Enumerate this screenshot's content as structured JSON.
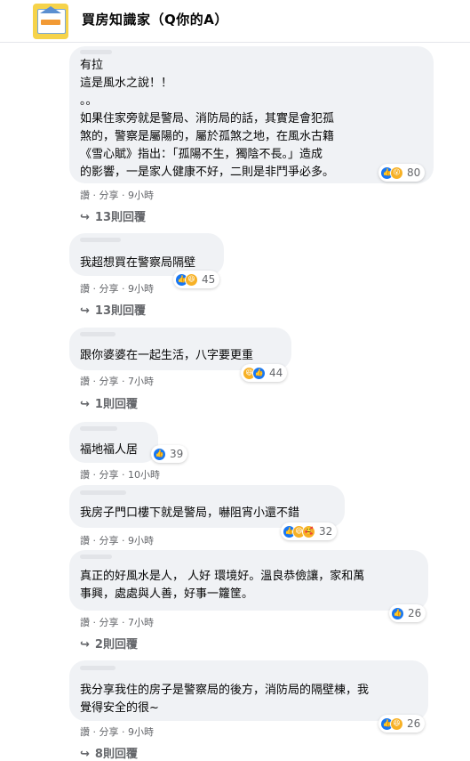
{
  "header": {
    "group_name": "買房知識家（Q你的A）"
  },
  "actions": {
    "like": "讚",
    "sep": "·",
    "share": "分享"
  },
  "comments": [
    {
      "text": "有拉\n這是風水之說！！\n。。\n如果住家旁就是警局、消防局的話，其實是會犯孤\n煞的，警察是屬陽的，屬於孤煞之地，在風水古籍\n《雪心賦》指出：「孤陽不生，獨陰不長。」造成\n的影響，一是家人健康不好，二則是非鬥爭必多。",
      "reaction_icons": [
        "like-icon",
        "wow-icon"
      ],
      "reaction_count": "80",
      "time": "9小時",
      "replies": "13則回覆"
    },
    {
      "text": "我超想買在警察局隔壁",
      "reaction_icons": [
        "like-icon",
        "haha-icon"
      ],
      "reaction_count": "45",
      "time": "9小時",
      "replies": "13則回覆"
    },
    {
      "text": "跟你婆婆在一起生活，八字要更重",
      "reaction_icons": [
        "haha-icon",
        "like-icon"
      ],
      "reaction_count": "44",
      "time": "7小時",
      "replies": "1則回覆"
    },
    {
      "text": "福地福人居",
      "reaction_icons": [
        "like-icon"
      ],
      "reaction_count": "39",
      "time": "10小時",
      "replies": ""
    },
    {
      "text": "我房子門口樓下就是警局，嚇阻宵小還不錯",
      "reaction_icons": [
        "like-icon",
        "haha-icon",
        "care-icon"
      ],
      "reaction_count": "32",
      "time": "9小時",
      "replies": ""
    },
    {
      "text": "真正的好風水是人， 人好 環境好。溫良恭儉讓，家和萬\n事興，處處與人善，好事一籮筐。",
      "reaction_icons": [
        "like-icon"
      ],
      "reaction_count": "26",
      "time": "7小時",
      "replies": "2則回覆"
    },
    {
      "text": "我分享我住的房子是警察局的後方，消防局的隔壁棟，我\n覺得安全的很~",
      "reaction_icons": [
        "like-icon",
        "haha-icon"
      ],
      "reaction_count": "26",
      "time": "9小時",
      "replies": "8則回覆"
    }
  ]
}
